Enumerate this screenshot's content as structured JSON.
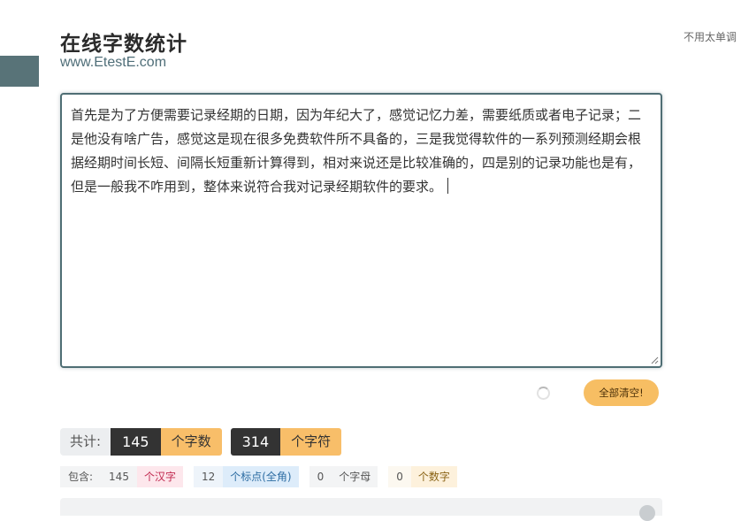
{
  "header": {
    "title": "在线字数统计",
    "subtitle": "www.EtestE.com",
    "top_right": "不用太单调"
  },
  "editor": {
    "text": "首先是为了方便需要记录经期的日期，因为年纪大了，感觉记忆力差，需要纸质或者电子记录；二是他没有啥广告，感觉这是现在很多免费软件所不具备的，三是我觉得软件的一系列预测经期会根据经期时间长短、间隔长短重新计算得到，相对来说还是比较准确的，四是别的记录功能也是有，但是一般我不咋用到，整体来说符合我对记录经期软件的要求。"
  },
  "actions": {
    "clear_label": "全部清空!"
  },
  "stats": {
    "total_label": "共计:",
    "word_count": "145",
    "word_unit": "个字数",
    "char_count": "314",
    "char_unit": "个字符"
  },
  "breakdown": {
    "label": "包含:",
    "han_count": "145",
    "han_label": "个汉字",
    "punct_count": "12",
    "punct_label": "个标点(全角)",
    "letter_count": "0",
    "letter_label": "个字母",
    "digit_count": "0",
    "digit_label": "个数字"
  },
  "colors": {
    "accent": "#4f6e74",
    "side_tab": "#587378",
    "button": "#f7be63",
    "dark": "#333333"
  }
}
